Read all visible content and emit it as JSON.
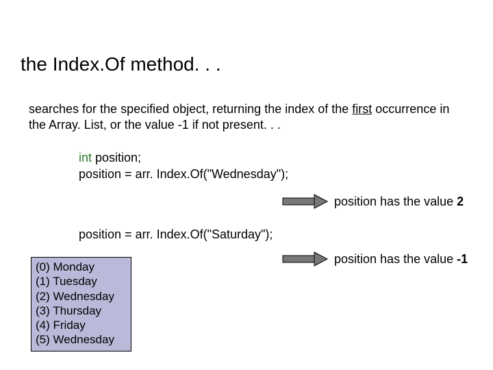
{
  "title": "the Index.Of method. . .",
  "desc_pre": "searches for the specified object, returning the index of the ",
  "desc_underlined": "first",
  "desc_post": " occurrence in the Array. List, or the value -1 if not present. . .",
  "code1_kw": "int",
  "code1_line1_rest": " position;",
  "code1_line2": "position = arr. Index.Of(\"Wednesday\");",
  "result1_pre": "position has the value ",
  "result1_val": "2",
  "code2": "position = arr. Index.Of(\"Saturday\");",
  "result2_pre": "position has the value ",
  "result2_val": "-1",
  "list": {
    "0": "(0) Monday",
    "1": "(1) Tuesday",
    "2": "(2) Wednesday",
    "3": "(3) Thursday",
    "4": "(4) Friday",
    "5": "(5) Wednesday"
  }
}
